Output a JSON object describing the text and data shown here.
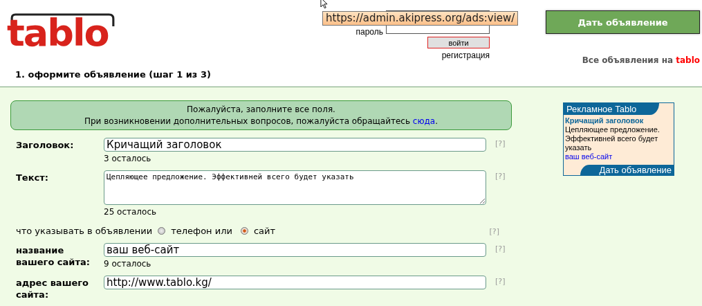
{
  "logo": {
    "text": "tablo"
  },
  "tooltip": "https://admin.akipress.org/ads:view/",
  "login": {
    "password_label": "пароль",
    "submit": "войти",
    "register": "регистрация"
  },
  "post_button": "Дать объявление",
  "all_ads": {
    "text": "Все объявления на",
    "brand": "tablo"
  },
  "step_title": "1. оформите объявление (шаг 1 из 3)",
  "notice": {
    "line1": "Пожалуйста, заполните все поля.",
    "line2": "При возникновении дополнительных вопросов, пожалуйста обращайтесь",
    "link": "сюда",
    "end": "."
  },
  "fields": [
    {
      "kind": "input",
      "label": "Заголовок:",
      "value": "Кричащий заголовок",
      "remaining": "3 осталось",
      "help": "[?]"
    },
    {
      "kind": "textarea",
      "label": "Текст:",
      "value": "Цепляющее предложение. Эффективней всего будет указать",
      "remaining": "25 осталось",
      "help": "[?]"
    },
    {
      "kind": "radio",
      "label": "что указывать в объявлении",
      "options": [
        {
          "label": "телефон или",
          "selected": false
        },
        {
          "label": "сайт",
          "selected": true
        }
      ],
      "help": "[?]"
    },
    {
      "kind": "input",
      "label": "название вашего сайта:",
      "value": "ваш веб-сайт",
      "remaining": "9 осталось",
      "help": "[?]"
    },
    {
      "kind": "input",
      "label": "адрес вашего сайта:",
      "value": "http://www.tablo.kg/",
      "help": "[?]"
    }
  ],
  "ad": {
    "title": "Рекламное Tablo",
    "headline": "Кричащий заголовок",
    "body": "Цепляющее предложение. Эффективней всего будет указать",
    "link": "ваш веб-сайт",
    "footer": "Дать объявление"
  }
}
